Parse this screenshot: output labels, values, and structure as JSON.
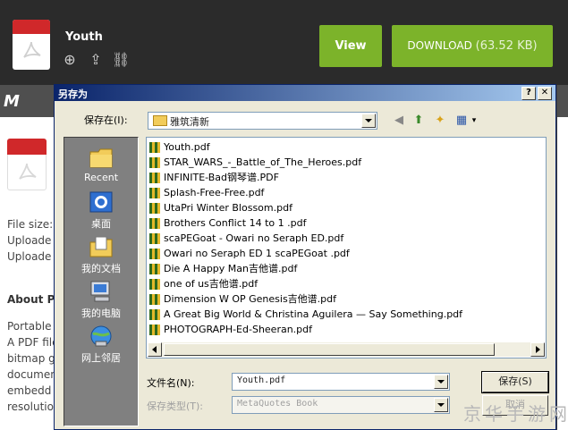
{
  "site": {
    "file_title": "Youth",
    "view_label": "View",
    "download_label": "DOWNLOAD",
    "download_size": "(63.52 KB)",
    "brand": "M",
    "info_lines": [
      "File size:",
      "Uploade",
      "Uploade"
    ],
    "about_heading": "About P",
    "about_lines": [
      "Portable",
      "A PDF file",
      "bitmap g",
      "documen",
      "embedd",
      "resolutio"
    ],
    "header_icons": [
      "plus-icon",
      "share-icon",
      "link-icon"
    ]
  },
  "dialog": {
    "title": "另存为",
    "help_btn": "?",
    "close_btn": "✕",
    "save_in_label": "保存在(I):",
    "save_in_value": "雅筑清新",
    "places": [
      {
        "label": "Recent",
        "icon": "recent-folder-icon"
      },
      {
        "label": "桌面",
        "icon": "desktop-icon"
      },
      {
        "label": "我的文档",
        "icon": "my-documents-icon"
      },
      {
        "label": "我的电脑",
        "icon": "my-computer-icon"
      },
      {
        "label": "网上邻居",
        "icon": "network-places-icon"
      }
    ],
    "files": [
      "Youth.pdf",
      "STAR_WARS_-_Battle_of_The_Heroes.pdf",
      "INFINITE-Bad钢琴谱.PDF",
      "Splash-Free-Free.pdf",
      "UtaPri Winter Blossom.pdf",
      "Brothers Conflict 14 to 1 .pdf",
      "scaPEGoat - Owari no Seraph ED.pdf",
      "Owari no Seraph ED 1 scaPEGoat .pdf",
      "Die A Happy Man吉他谱.pdf",
      "one of us吉他谱.pdf",
      "Dimension W OP Genesis吉他谱.pdf",
      "A Great Big World & Christina Aguilera — Say Something.pdf",
      "PHOTOGRAPH-Ed-Sheeran.pdf"
    ],
    "filename_label": "文件名(N):",
    "filename_value": "Youth.pdf",
    "filetype_label": "保存类型(T):",
    "filetype_value": "MetaQuotes Book",
    "save_button": "保存(S)",
    "cancel_button": "取消"
  },
  "watermark": "京华手游网",
  "colors": {
    "accent_green": "#7cb32a",
    "header_dark": "#2b2b2b",
    "pdf_red": "#d0282a",
    "title_blue": "#0a246a"
  }
}
